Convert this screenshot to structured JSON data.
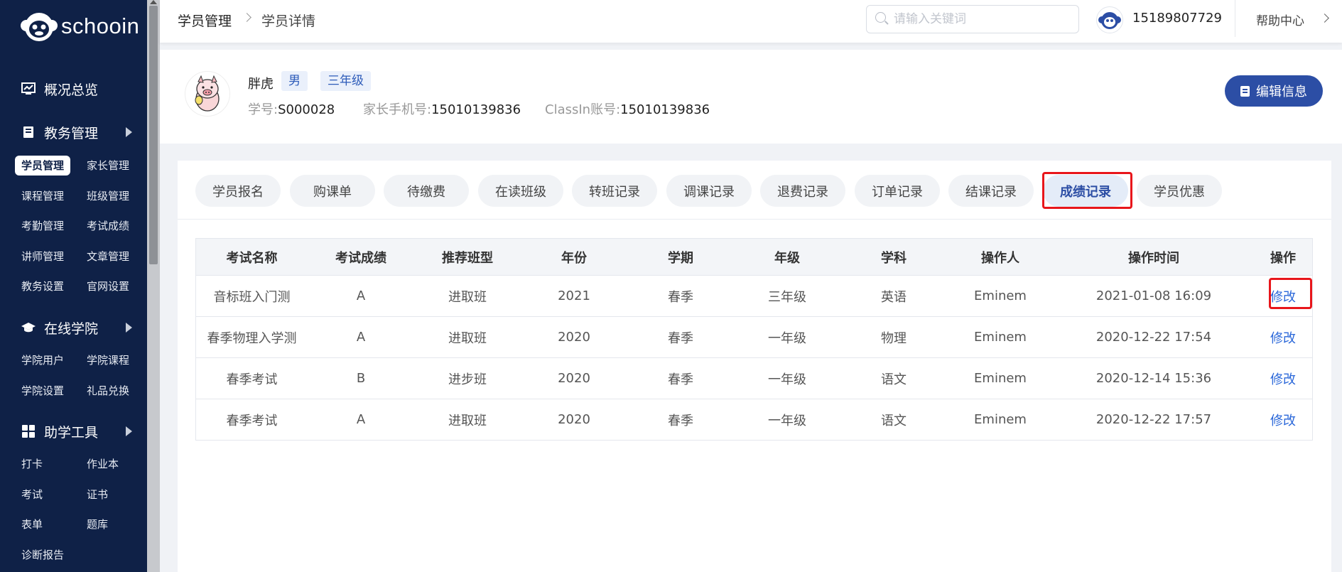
{
  "app": {
    "logo_text": "schooin"
  },
  "sidebar": {
    "groups": [
      {
        "title": "概况总览",
        "icon": "chart-icon"
      },
      {
        "title": "教务管理",
        "icon": "book-icon",
        "items": [
          "学员管理",
          "家长管理",
          "课程管理",
          "班级管理",
          "考勤管理",
          "考试成绩",
          "讲师管理",
          "文章管理",
          "教务设置",
          "官网设置"
        ],
        "active": "学员管理"
      },
      {
        "title": "在线学院",
        "icon": "graduation-cap-icon",
        "items": [
          "学院用户",
          "学院课程",
          "学院设置",
          "礼品兑换"
        ]
      },
      {
        "title": "助学工具",
        "icon": "grid-icon",
        "items": [
          "打卡",
          "作业本",
          "考试",
          "证书",
          "表单",
          "题库",
          "诊断报告"
        ]
      }
    ]
  },
  "header": {
    "breadcrumb": [
      "学员管理",
      "学员详情"
    ],
    "search_placeholder": "请输入关键词",
    "user_phone": "15189807729",
    "help": "帮助中心"
  },
  "profile": {
    "name": "胖虎",
    "gender": "男",
    "grade": "三年级",
    "student_no_label": "学号:",
    "student_no": "S000028",
    "parent_phone_label": "家长手机号:",
    "parent_phone": "15010139836",
    "classin_label": "ClassIn账号:",
    "classin": "15010139836",
    "edit_button": "编辑信息"
  },
  "tabs": [
    "学员报名",
    "购课单",
    "待缴费",
    "在读班级",
    "转班记录",
    "调课记录",
    "退费记录",
    "订单记录",
    "结课记录",
    "成绩记录",
    "学员优惠"
  ],
  "active_tab": "成绩记录",
  "table": {
    "columns": [
      "考试名称",
      "考试成绩",
      "推荐班型",
      "年份",
      "学期",
      "年级",
      "学科",
      "操作人",
      "操作时间",
      "操作"
    ],
    "rows": [
      [
        "音标班入门测",
        "A",
        "进取班",
        "2021",
        "春季",
        "三年级",
        "英语",
        "Eminem",
        "2021-01-08 16:09",
        "修改"
      ],
      [
        "春季物理入学测",
        "A",
        "进取班",
        "2020",
        "春季",
        "一年级",
        "物理",
        "Eminem",
        "2020-12-22 17:54",
        "修改"
      ],
      [
        "春季考试",
        "B",
        "进步班",
        "2020",
        "春季",
        "一年级",
        "语文",
        "Eminem",
        "2020-12-14 15:36",
        "修改"
      ],
      [
        "春季考试",
        "A",
        "进取班",
        "2020",
        "春季",
        "一年级",
        "语文",
        "Eminem",
        "2020-12-22 17:57",
        "修改"
      ]
    ]
  },
  "colors": {
    "sidebar_bg": "#0f2147",
    "primary": "#2c4ea5",
    "link": "#2a67d9",
    "highlight": "#e8161b"
  }
}
